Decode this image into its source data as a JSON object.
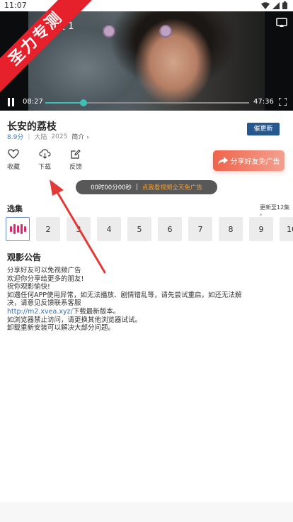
{
  "status_bar": {
    "time": "11:07"
  },
  "watermark": {
    "text": "圣力专测"
  },
  "player": {
    "episode_title": "荔枝 1",
    "current_time": "08:27",
    "duration": "47:36",
    "progress": 0.186
  },
  "show": {
    "title": "长安的荔枝",
    "score": "8.9分",
    "region": "大陆",
    "year": "2025",
    "intro_label": "简介",
    "urge_button": "催更新"
  },
  "actions": [
    {
      "label": "收藏",
      "icon": "heart-icon"
    },
    {
      "label": "下载",
      "icon": "download-icon"
    },
    {
      "label": "反馈",
      "icon": "feedback-icon"
    }
  ],
  "share_button": "分享好友免广告",
  "timer": {
    "time": "00时00分00秒",
    "separator": "|",
    "ad_text": "点我看视频全天免广告"
  },
  "episodes": {
    "header": "选集",
    "more": "更新至12集",
    "items": [
      "2",
      "3",
      "4",
      "5",
      "6",
      "7",
      "8",
      "9",
      "10"
    ]
  },
  "notice": {
    "title": "观影公告",
    "lines": [
      "分享好友可以免视频广告",
      "欢迎你分享给更多的朋友!",
      "祝你观影愉快!",
      "如遇任何APP使用异常，如无法播放、剧情错乱等，请先尝试重启，如还无法解",
      "决，请意见反馈联系客服"
    ],
    "link": "http://m2.xvea.xyz/",
    "link_suffix": "下载最新版本。",
    "lines_after": [
      "如浏览器禁止访问，请更换其他浏览器试试。",
      "卸载重新安装可以解决大部分问题。"
    ]
  },
  "colors": {
    "accent_teal": "#3dc0b8",
    "urge_blue": "#25588f",
    "ribbon_red": "#e6212b",
    "arrow_red": "#e23a36",
    "share_gradient_start": "#f0634b",
    "ad_orange": "#f0a13c",
    "playing_bars": "#e0276a"
  }
}
